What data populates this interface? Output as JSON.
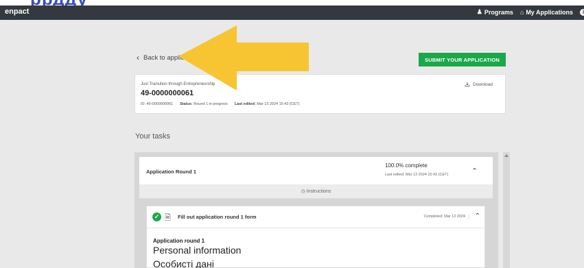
{
  "overlay": {
    "top_text": "ррдду"
  },
  "navbar": {
    "brand": "enpact",
    "programs": "Programs",
    "my_applications": "My Applications"
  },
  "back_link": "Back to application",
  "submit_button": "SUBMIT YOUR APPLICATION",
  "application": {
    "program": "Just Transition through Entrepreneurship",
    "number": "49-0000000061",
    "id_label": "ID:",
    "id_value": "49-0000000061",
    "status_label": "Status:",
    "status_value": "Round 1 in progress",
    "last_edited_label": "Last edited:",
    "last_edited_value": "Mar 13 2024 15:43 (CET)",
    "download": "Download"
  },
  "tasks": {
    "title": "Your tasks",
    "round": {
      "title": "Application Round 1",
      "progress": "100.0% complete",
      "last_edited": "Last edited: Mar 13 2024 15:43 (CET)"
    },
    "instructions": "Instructions",
    "task": {
      "title": "Fill out application round 1 form",
      "completed": "Completed: Mar 13 2024",
      "form_label": "Application round 1",
      "heading_en": "Personal information",
      "heading_uk": "Особисті дані"
    }
  },
  "colors": {
    "navbar": "#34393f",
    "submit": "#1aa84a",
    "arrow": "#f7c531",
    "overlay_text": "#3a4dbb"
  },
  "icons": [
    "user-icon",
    "home-icon",
    "info-icon",
    "chevron-left-icon",
    "download-icon",
    "chevron-up-icon",
    "clock-icon",
    "check-circle-icon",
    "document-icon",
    "arrow-overlay"
  ]
}
